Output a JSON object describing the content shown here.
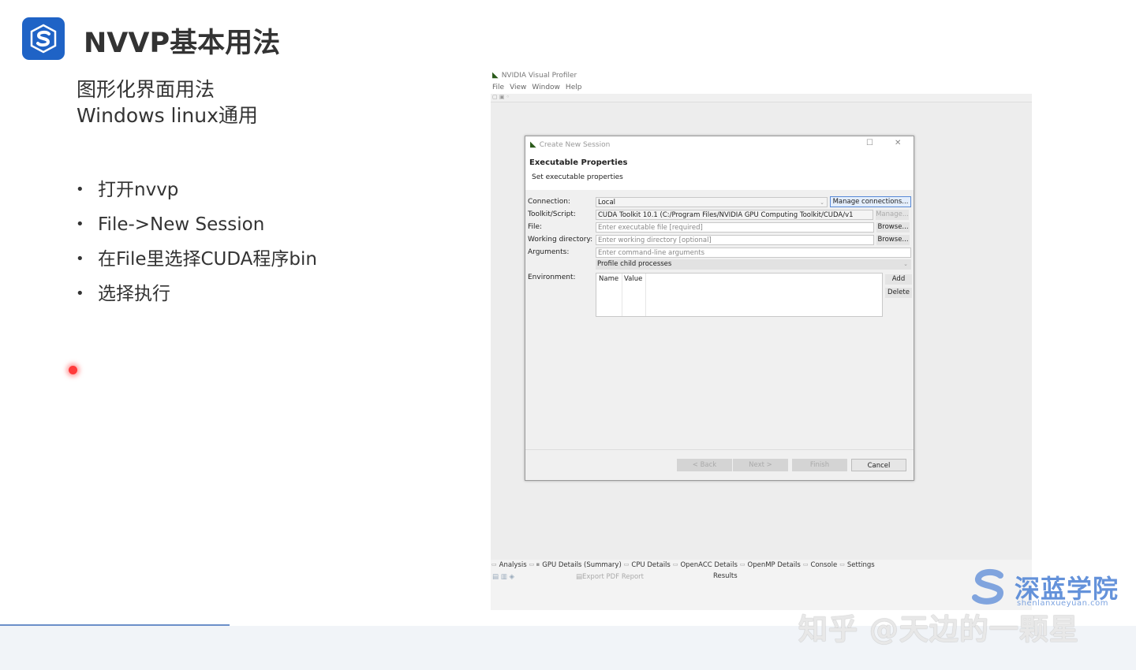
{
  "slide": {
    "title": "NVVP基本用法",
    "subtitle_line1": "图形化界面用法",
    "subtitle_line2": "Windows linux通用",
    "bullets": [
      "打开nvvp",
      "File->New Session",
      "在File里选择CUDA程序bin",
      "选择执行"
    ],
    "brand_color": "#1f63c6"
  },
  "nvvp": {
    "window_title": "NVIDIA Visual Profiler",
    "menu": [
      "File",
      "View",
      "Window",
      "Help"
    ],
    "bottom_tabs": [
      "Analysis",
      "GPU Details (Summary)",
      "CPU Details",
      "OpenACC Details",
      "OpenMP Details",
      "Console",
      "Settings"
    ],
    "export_pdf": "Export PDF Report",
    "results": "Results"
  },
  "dialog": {
    "title": "Create New Session",
    "heading": "Executable Properties",
    "subheading": "Set executable properties",
    "fields": {
      "connection": {
        "label": "Connection:",
        "value": "Local",
        "button": "Manage connections..."
      },
      "toolkit": {
        "label": "Toolkit/Script:",
        "value": "CUDA Toolkit 10.1 (C:/Program Files/NVIDIA GPU Computing Toolkit/CUDA/v1",
        "button": "Manage..."
      },
      "file": {
        "label": "File:",
        "placeholder": "Enter executable file [required]",
        "button": "Browse..."
      },
      "working_dir": {
        "label": "Working directory:",
        "placeholder": "Enter working directory [optional]",
        "button": "Browse..."
      },
      "arguments": {
        "label": "Arguments:",
        "placeholder": "Enter command-line arguments"
      },
      "profile_child": "Profile child processes",
      "environment": {
        "label": "Environment:",
        "col_name": "Name",
        "col_value": "Value",
        "add": "Add",
        "delete": "Delete"
      }
    },
    "footer": {
      "back": "< Back",
      "next": "Next >",
      "finish": "Finish",
      "cancel": "Cancel"
    }
  },
  "watermarks": {
    "brand": "深蓝学院",
    "brand_url": "shenlanxueyuan.com",
    "zhihu": "知乎 @天边的一颗星"
  }
}
